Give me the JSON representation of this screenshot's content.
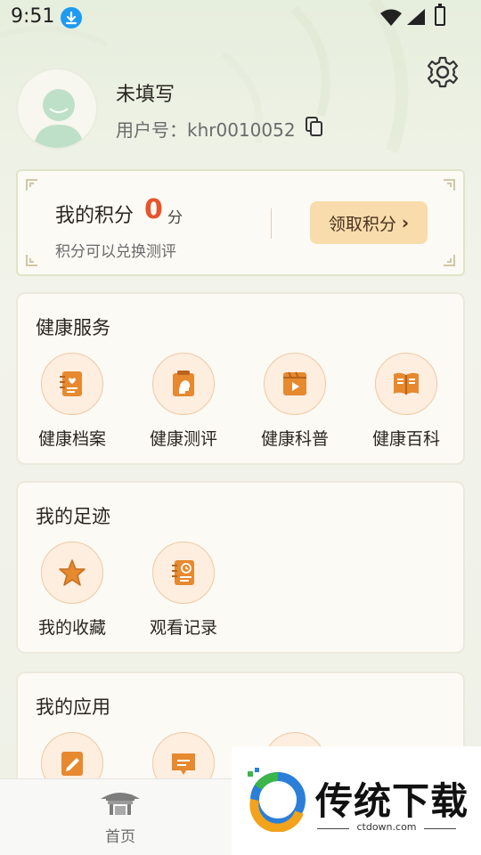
{
  "status_bar": {
    "time": "9:51"
  },
  "profile": {
    "nickname": "未填写",
    "user_id_label": "用户号：",
    "user_id": "khr0010052"
  },
  "points": {
    "title": "我的积分",
    "value": "0",
    "unit": "分",
    "subtitle": "积分可以兑换测评",
    "claim_label": "领取积分"
  },
  "health_services": {
    "title": "健康服务",
    "items": [
      {
        "label": "健康档案",
        "icon": "health-record-icon"
      },
      {
        "label": "健康测评",
        "icon": "health-assessment-icon"
      },
      {
        "label": "健康科普",
        "icon": "health-video-icon"
      },
      {
        "label": "健康百科",
        "icon": "health-encyclopedia-icon"
      }
    ]
  },
  "footprints": {
    "title": "我的足迹",
    "items": [
      {
        "label": "我的收藏",
        "icon": "star-icon"
      },
      {
        "label": "观看记录",
        "icon": "watch-history-icon"
      }
    ]
  },
  "my_apps": {
    "title": "我的应用"
  },
  "tab_bar": {
    "home_label": "首页"
  },
  "watermark": {
    "title": "传统下载",
    "url": "ctdown.com"
  },
  "colors": {
    "accent": "#e8532c",
    "icon_orange": "#e6892f",
    "claim_bg": "#f8dcab"
  }
}
